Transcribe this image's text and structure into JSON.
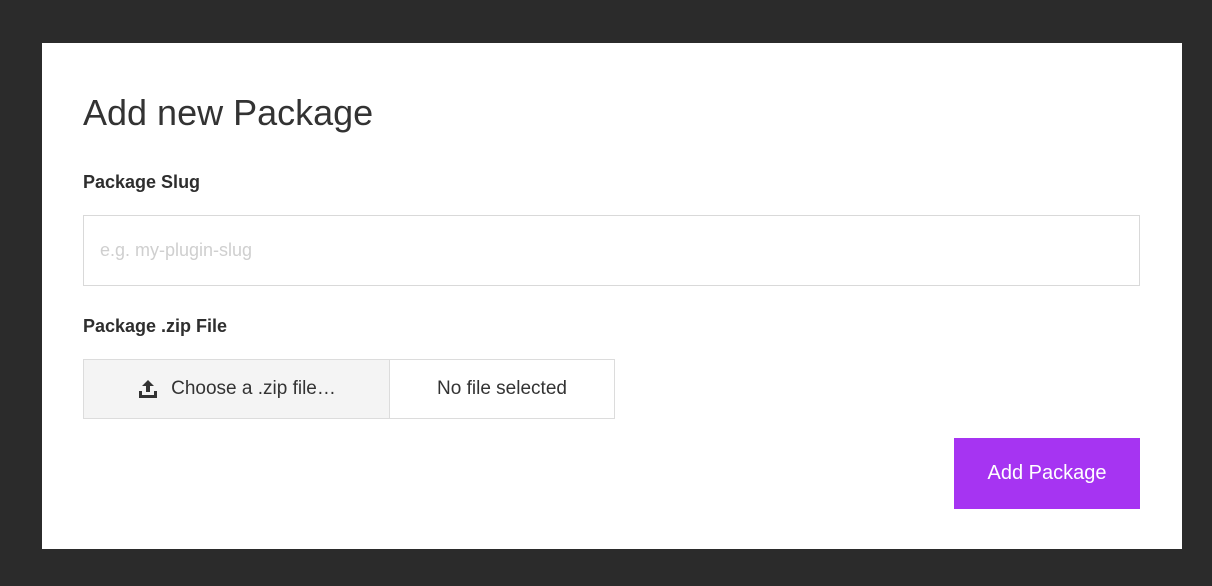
{
  "form": {
    "title": "Add new Package",
    "slug_label": "Package Slug",
    "slug_placeholder": "e.g. my-plugin-slug",
    "slug_value": "",
    "zip_label": "Package .zip File",
    "choose_file_label": "Choose a .zip file…",
    "file_status": "No file selected",
    "submit_label": "Add Package"
  },
  "icons": {
    "upload": "upload-icon"
  },
  "colors": {
    "background": "#2b2b2b",
    "card": "#ffffff",
    "accent": "#a634f2"
  }
}
